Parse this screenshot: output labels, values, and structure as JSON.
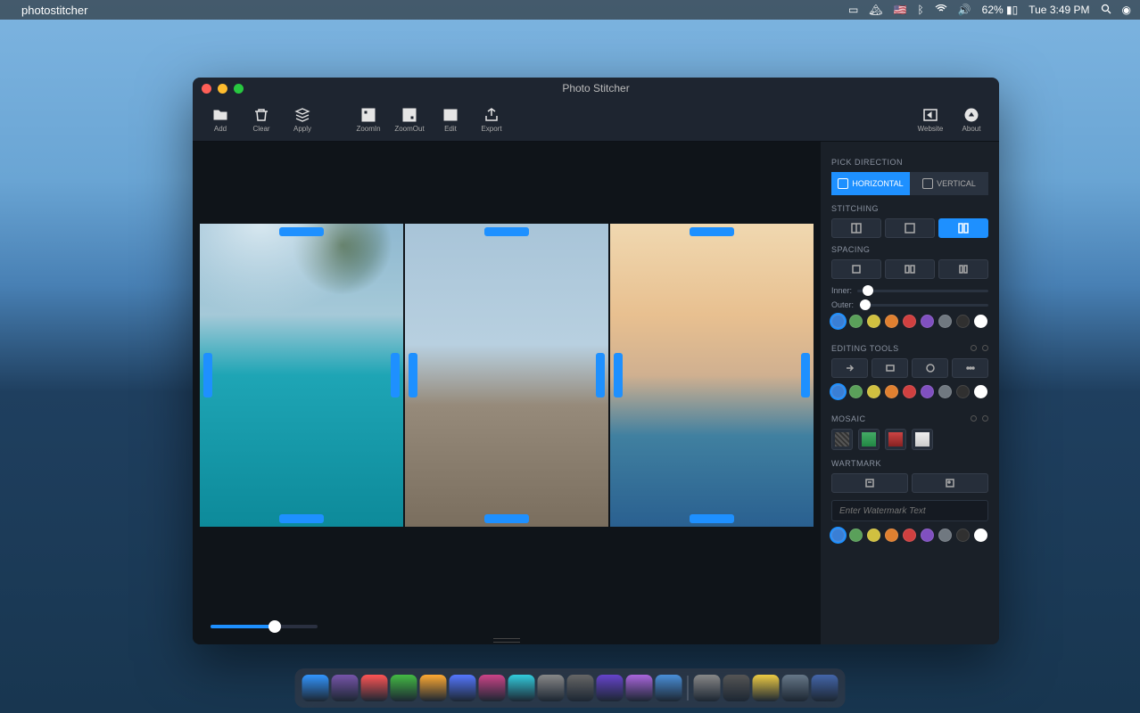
{
  "menubar": {
    "app_name": "photostitcher",
    "battery": "62%",
    "clock_day": "Tue",
    "clock_time": "3:49 PM"
  },
  "window": {
    "title": "Photo Stitcher"
  },
  "toolbar": {
    "add": "Add",
    "clear": "Clear",
    "apply": "Apply",
    "zoom_in": "ZoomIn",
    "zoom_out": "ZoomOut",
    "edit": "Edit",
    "export": "Export",
    "website": "Website",
    "about": "About"
  },
  "sidebar": {
    "direction_title": "PICK DIRECTION",
    "horizontal": "HORIZONTAL",
    "vertical": "VERTICAL",
    "stitching_title": "STITCHING",
    "spacing_title": "SPACING",
    "inner_label": "Inner:",
    "outer_label": "Outer:",
    "editing_title": "EDITING TOOLS",
    "mosaic_title": "MOSAIC",
    "watermark_title": "WARTMARK",
    "watermark_placeholder": "Enter Watermark Text"
  },
  "colors": {
    "palette": [
      "#3a7fd5",
      "#5aa05a",
      "#d0c040",
      "#e08030",
      "#d04040",
      "#8050c0",
      "#707880",
      "#303030",
      "#ffffff"
    ],
    "accent": "#1e90ff"
  },
  "zoom": {
    "value_pct": 60
  },
  "photos": [
    "photo-1",
    "photo-2",
    "photo-3"
  ],
  "dock": {
    "item_count": 18
  }
}
